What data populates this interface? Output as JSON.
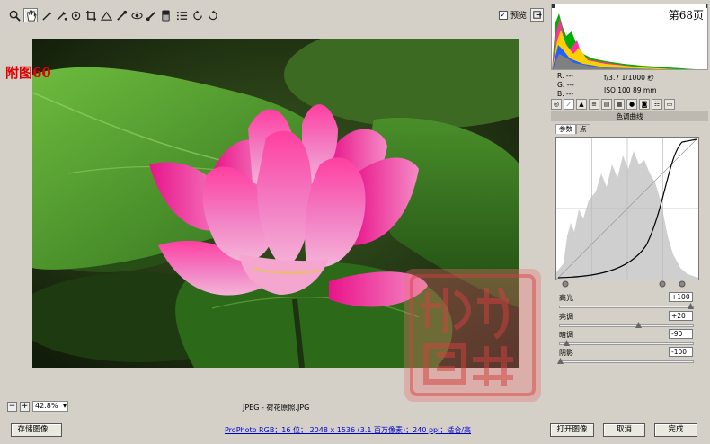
{
  "toolbar": {
    "tools": [
      "zoom-tool",
      "hand-tool",
      "white-balance-tool",
      "color-sampler-tool",
      "targeted-adjustment-tool",
      "crop-tool",
      "straighten-tool",
      "spot-removal-tool",
      "red-eye-tool",
      "adjustment-brush-tool",
      "graduated-filter-tool",
      "preferences-tool",
      "rotate-left-tool",
      "rotate-right-tool"
    ],
    "preview_label": "预览",
    "preview_checked": "✓"
  },
  "image": {
    "figure_label": "附图60",
    "zoom_value": "42.8%",
    "zoom_minus": "−",
    "zoom_plus": "+",
    "filename": "JPEG - 荷花原照.JPG"
  },
  "panel": {
    "page_number": "第68页",
    "rgb": {
      "r": "R:  ---",
      "g": "G:  ---",
      "b": "B:  ---"
    },
    "exif": {
      "line1": "f/3.7   1/1000 秒",
      "line2": "ISO 100   89 mm"
    },
    "section_title": "色调曲线",
    "subtabs": [
      "参数",
      "点"
    ],
    "sliders": [
      {
        "label": "高光",
        "value": "+100",
        "pos": 1.0
      },
      {
        "label": "亮调",
        "value": "+20",
        "pos": 0.6
      },
      {
        "label": "暗调",
        "value": "-90",
        "pos": 0.05
      },
      {
        "label": "阴影",
        "value": "-100",
        "pos": 0.0
      }
    ]
  },
  "bottom": {
    "save_label": "存储图像...",
    "info_text": "ProPhoto RGB；16 位； 2048 x 1536 (3.1 百万像素)；240 ppi；适合/高",
    "open_label": "打开图像",
    "cancel_label": "取消",
    "done_label": "完成"
  },
  "colors": {
    "accent": "#0000cc",
    "label_red": "#e00000"
  }
}
